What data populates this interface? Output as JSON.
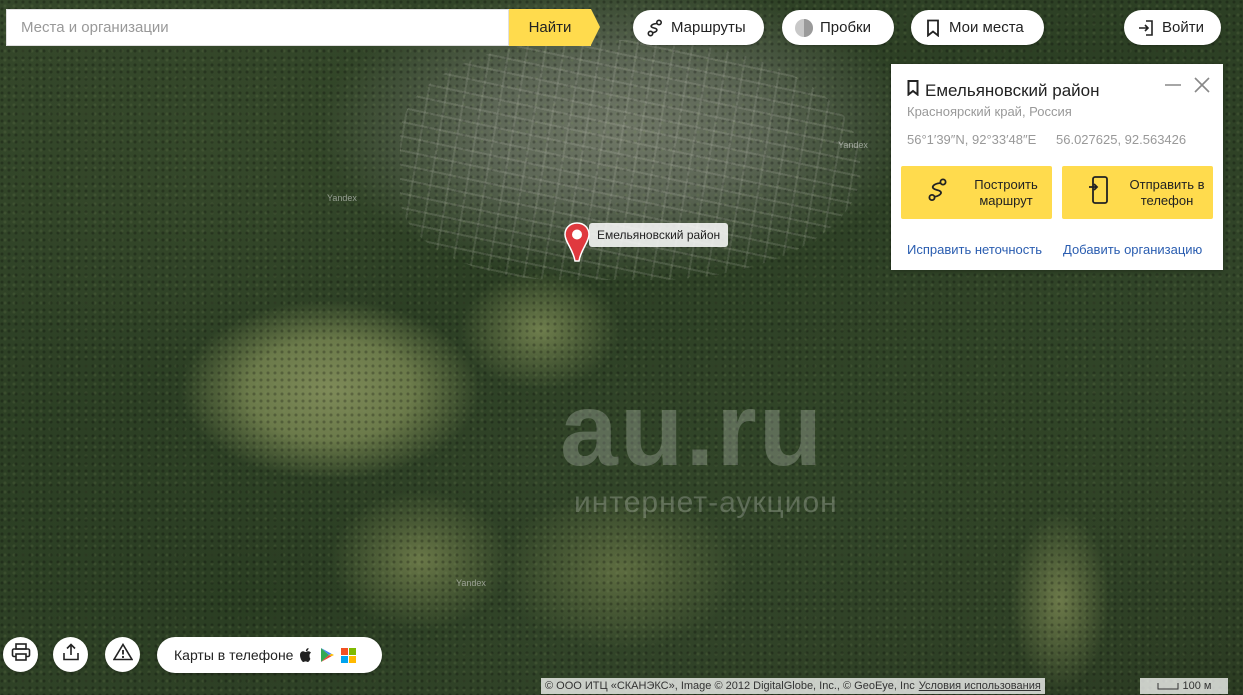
{
  "search": {
    "placeholder": "Места и организации",
    "button": "Найти"
  },
  "toolbar": {
    "routes": "Маршруты",
    "traffic": "Пробки",
    "my_places": "Мои места",
    "login": "Войти"
  },
  "map_labels": [
    "Yandex",
    "Yandex",
    "Yandex"
  ],
  "watermark": {
    "main": "au.ru",
    "sub": "интернет-аукцион"
  },
  "marker": {
    "label": "Емельяновский район"
  },
  "card": {
    "title": "Емельяновский район",
    "subtitle": "Красноярский край, Россия",
    "coords_dms": "56°1′39″N, 92°33′48″E",
    "coords_decimal": "56.027625, 92.563426",
    "route_button": "Построить маршрут",
    "send_button": "Отправить в телефон",
    "fix_link": "Исправить неточность",
    "add_org_link": "Добавить организацию"
  },
  "bottom": {
    "apps_label": "Карты в телефоне",
    "copyright": "© ООО ИТЦ «СКАНЭКС», Image © 2012 DigitalGlobe, Inc., © GeoEye, Inc",
    "terms": "Условия использования",
    "scale": "100 м"
  },
  "colors": {
    "accent": "#ffdb4d",
    "link": "#2a5db0",
    "marker": "#e0393e"
  },
  "icons": [
    "route-icon",
    "traffic-icon",
    "bookmark-icon",
    "login-icon",
    "minimize-icon",
    "close-icon",
    "print-icon",
    "share-icon",
    "warning-icon",
    "apple-icon",
    "google-play-icon",
    "windows-icon",
    "map-pin-icon"
  ]
}
